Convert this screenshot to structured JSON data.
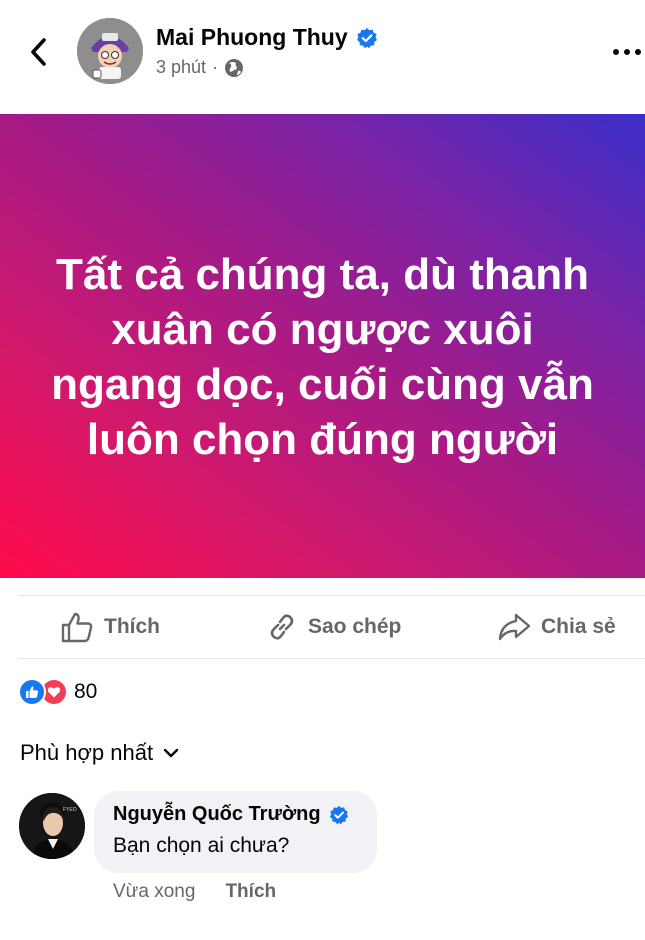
{
  "header": {
    "author_name": "Mai Phuong Thuy",
    "timestamp": "3 phút",
    "separator": "·",
    "back_icon": "chevron-left-icon",
    "privacy_icon": "globe-icon",
    "more_icon": "more-dots-icon"
  },
  "post": {
    "text": "Tất cả chúng ta, dù thanh xuân có ngược xuôi ngang dọc, cuối cùng vẫn luôn chọn đúng người",
    "bg_gradient": [
      "#ff0a4a",
      "#a41b87",
      "#3a2ec8"
    ]
  },
  "actions": {
    "like_label": "Thích",
    "copy_label": "Sao chép",
    "share_label": "Chia sẻ"
  },
  "reactions": {
    "count": "80",
    "types": [
      "like",
      "love"
    ]
  },
  "comments": {
    "sort_label": "Phù hợp nhất",
    "items": [
      {
        "name": "Nguyễn Quốc Trường",
        "text": "Bạn chọn ai chưa?",
        "time": "Vừa xong",
        "like_label": "Thích",
        "verified": true
      }
    ]
  },
  "colors": {
    "verified_blue": "#1877f2",
    "secondary_text": "#65676b",
    "bubble_bg": "#f0f2f5",
    "love_red": "#f33e58"
  }
}
